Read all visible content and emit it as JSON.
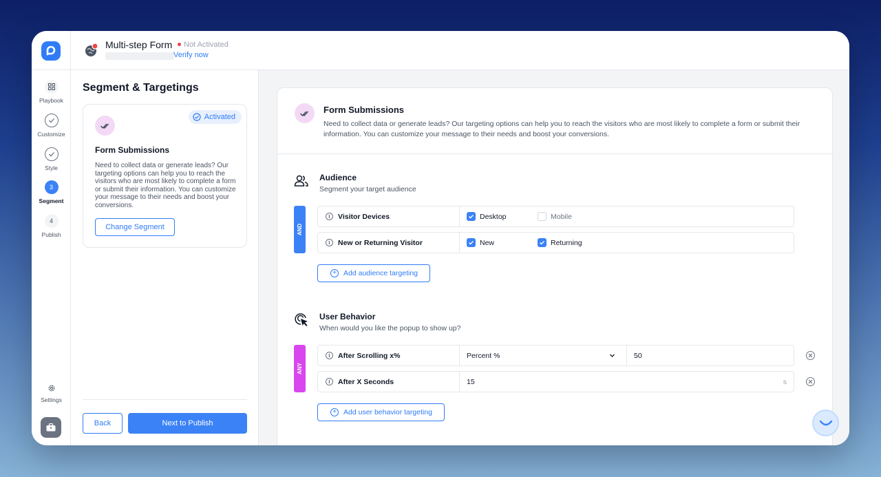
{
  "header": {
    "form_title": "Multi-step Form",
    "status": "Not Activated",
    "verify_link": "Verify now"
  },
  "sidenav": {
    "items": [
      {
        "label": "Playbook"
      },
      {
        "label": "Customize"
      },
      {
        "label": "Style"
      },
      {
        "label": "Segment",
        "step": "3"
      },
      {
        "label": "Publish",
        "step": "4"
      }
    ],
    "settings_label": "Settings"
  },
  "left_panel": {
    "title": "Segment & Targetings",
    "card": {
      "badge": "Activated",
      "title": "Form Submissions",
      "description": "Need to collect data or generate leads? Our targeting options can help you to reach the visitors who are most likely to complete a form or submit their information. You can customize your message to their needs and boost your conversions.",
      "button": "Change Segment"
    },
    "back_button": "Back",
    "next_button": "Next to Publish"
  },
  "main": {
    "title": "Form Submissions",
    "description": "Need to collect data or generate leads? Our targeting options can help you to reach the visitors who are most likely to complete a form or submit their information. You can customize your message to their needs and boost your conversions.",
    "audience": {
      "title": "Audience",
      "subtitle": "Segment your target audience",
      "logic": "AND",
      "rows": [
        {
          "label": "Visitor Devices",
          "options": [
            {
              "label": "Desktop",
              "checked": true
            },
            {
              "label": "Mobile",
              "checked": false
            }
          ]
        },
        {
          "label": "New or Returning Visitor",
          "options": [
            {
              "label": "New",
              "checked": true
            },
            {
              "label": "Returning",
              "checked": true
            }
          ]
        }
      ],
      "add_button": "Add audience targeting"
    },
    "behavior": {
      "title": "User Behavior",
      "subtitle": "When would you like the popup to show up?",
      "logic": "ANY",
      "rows": [
        {
          "label": "After Scrolling x%",
          "select": "Percent %",
          "value": "50"
        },
        {
          "label": "After X Seconds",
          "value": "15",
          "unit": "s"
        }
      ],
      "add_button": "Add user behavior targeting"
    }
  },
  "colors": {
    "accent": "#3b82f6",
    "and_bar": "#3b82f6",
    "any_bar": "#d946ef",
    "status_dot": "#ef4444"
  }
}
